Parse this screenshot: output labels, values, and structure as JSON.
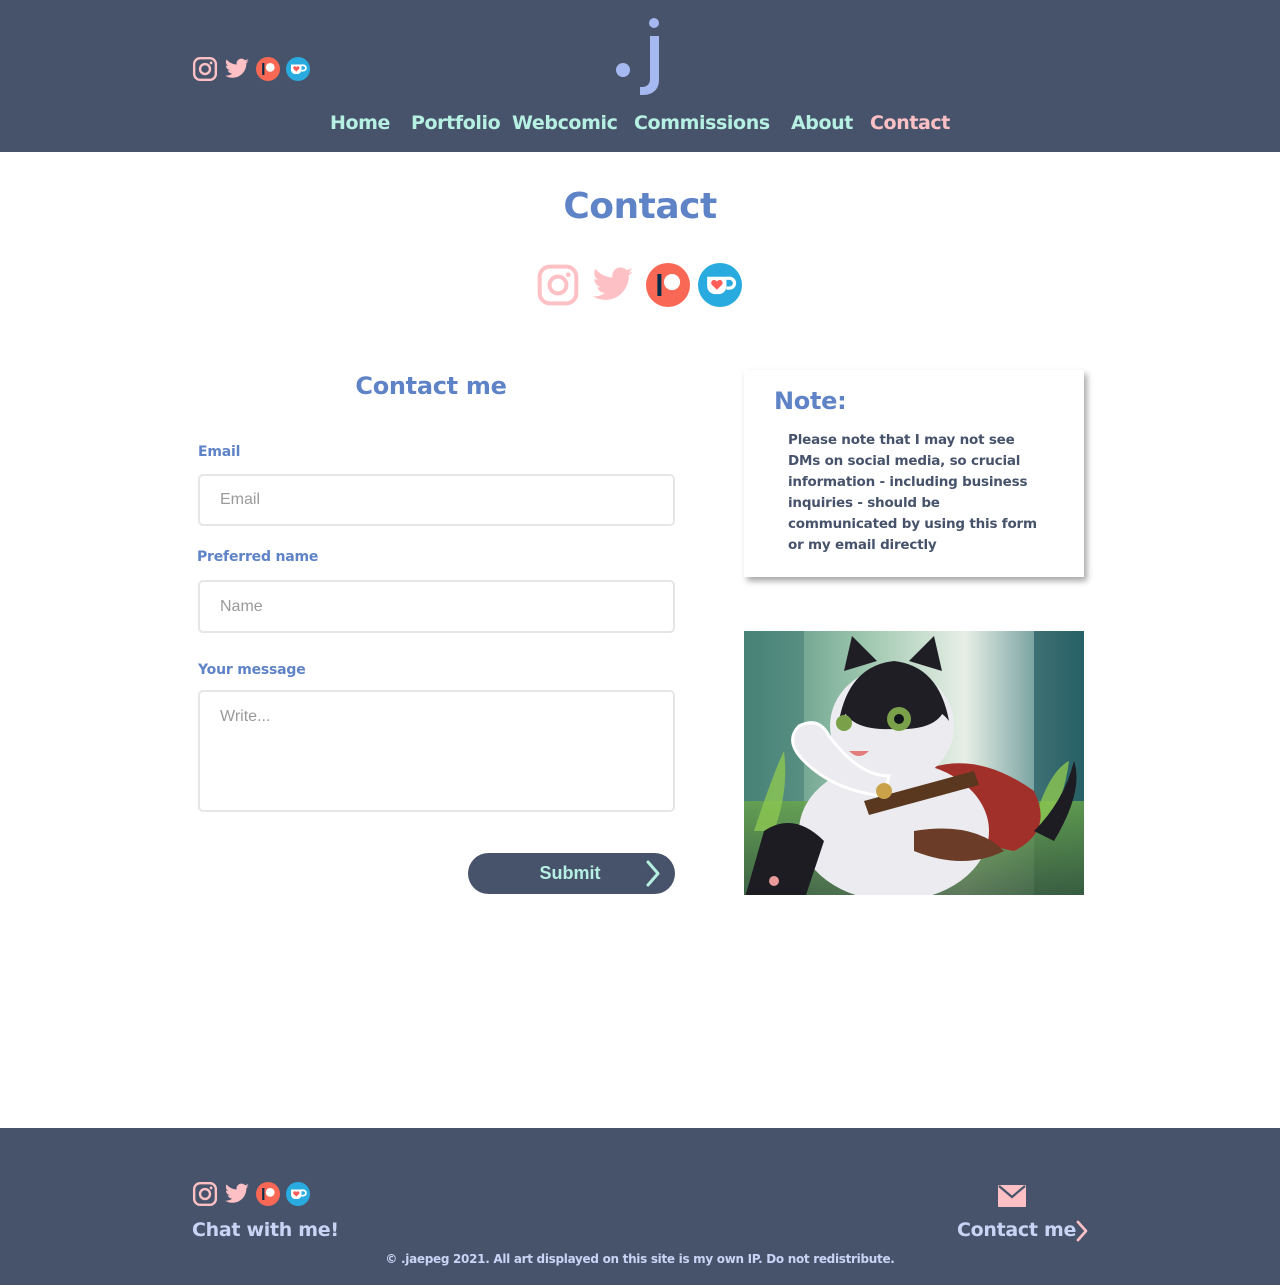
{
  "header": {
    "logo_text": ".j",
    "social": [
      {
        "icon": "instagram-icon"
      },
      {
        "icon": "twitter-icon"
      },
      {
        "icon": "patreon-icon"
      },
      {
        "icon": "kofi-icon"
      }
    ],
    "nav": [
      {
        "label": "Home",
        "active": false
      },
      {
        "label": "Portfolio",
        "active": false
      },
      {
        "label": "Webcomic",
        "active": false
      },
      {
        "label": "Commissions",
        "active": false
      },
      {
        "label": "About",
        "active": false
      },
      {
        "label": "Contact",
        "active": true
      }
    ]
  },
  "main": {
    "title": "Contact",
    "form": {
      "title": "Contact me",
      "email_label": "Email",
      "email_placeholder": "Email",
      "name_label": "Preferred name",
      "name_placeholder": "Name",
      "message_label": "Your message",
      "message_placeholder": "Write...",
      "submit_label": "Submit"
    },
    "note": {
      "title": "Note:",
      "body": "Please note that I may not see DMs on social media, so crucial information - including business inquiries -  should be communicated by using this form or my email directly"
    }
  },
  "footer": {
    "chat_label": "Chat with me!",
    "contact_label": "Contact me",
    "copyright": "© .jaepeg 2021. All art displayed on this site is my own IP. Do not redistribute."
  },
  "colors": {
    "header_bg": "#47536b",
    "accent_blue": "#5f83c7",
    "nav_mint": "#b6f0e2",
    "nav_active_pink": "#fdc1c5",
    "footer_text": "#c9d3f5",
    "patreon_orange": "#f96854",
    "kofi_blue": "#29abe0"
  }
}
